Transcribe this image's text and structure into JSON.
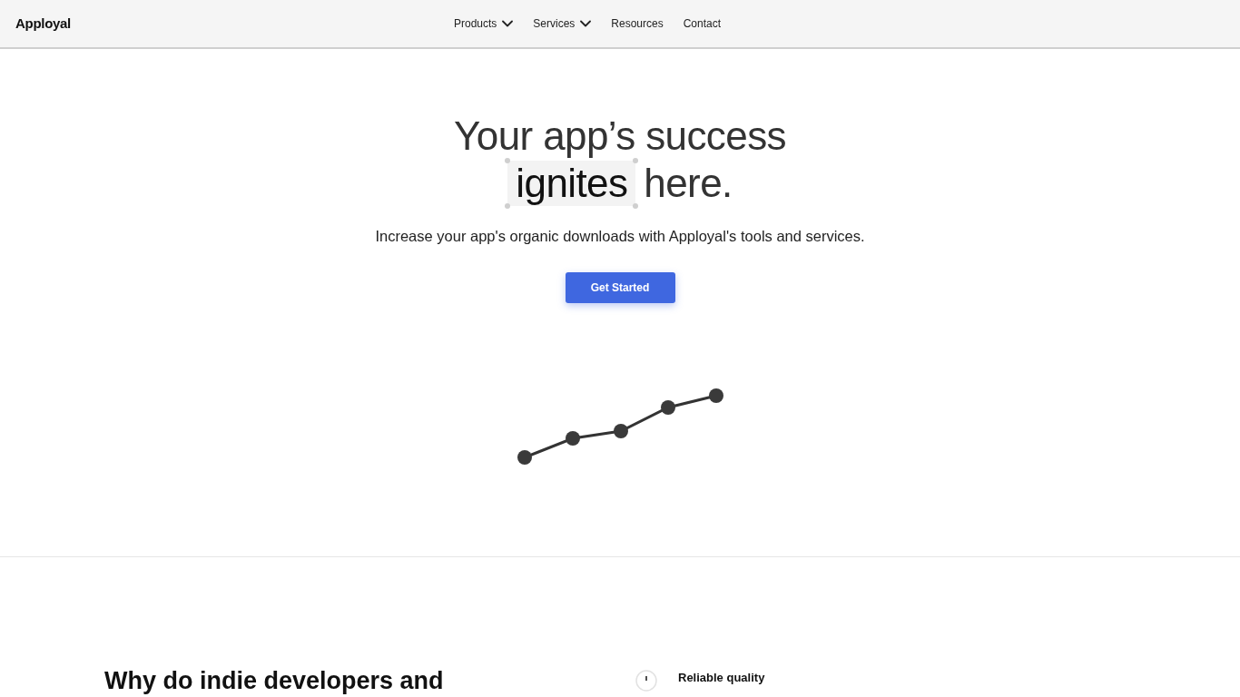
{
  "navbar": {
    "logo": "Apployal",
    "menu": [
      {
        "label": "Products",
        "kind": "dropdown"
      },
      {
        "label": "Services",
        "kind": "dropdown"
      },
      {
        "label": "Resources",
        "kind": "link"
      },
      {
        "label": "Contact",
        "kind": "link"
      }
    ]
  },
  "hero": {
    "headline": "Your app’s success",
    "highlighted_word": "ignites",
    "headline_end": "here.",
    "subtitle": "Increase your app's organic downloads with Apployal's tools and services.",
    "cta": "Get Started"
  },
  "features": {
    "heading": "Why do indie developers and",
    "items": [
      {
        "title": "Reliable quality"
      }
    ]
  }
}
